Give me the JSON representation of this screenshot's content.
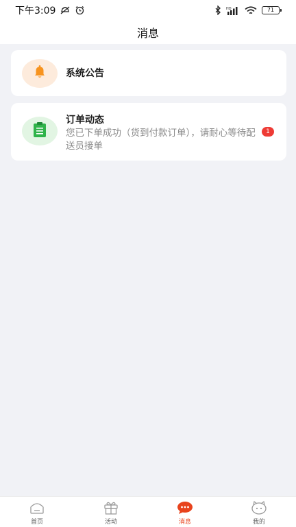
{
  "status_bar": {
    "time": "下午3:09",
    "battery": "71"
  },
  "header": {
    "title": "消息"
  },
  "messages": [
    {
      "title": "系统公告",
      "icon": "bell-icon",
      "icon_color": "#f7931e"
    },
    {
      "title": "订单动态",
      "description": "您已下单成功（货到付款订单），请耐心等待配送员接单",
      "badge": "1",
      "icon": "clipboard-icon",
      "icon_color": "#2fb34a"
    }
  ],
  "tabbar": {
    "active_color": "#e8431d",
    "tabs": [
      {
        "label": "首页",
        "icon": "home-icon"
      },
      {
        "label": "活动",
        "icon": "gift-icon"
      },
      {
        "label": "消息",
        "icon": "message-icon",
        "active": true
      },
      {
        "label": "我的",
        "icon": "profile-icon"
      }
    ]
  }
}
